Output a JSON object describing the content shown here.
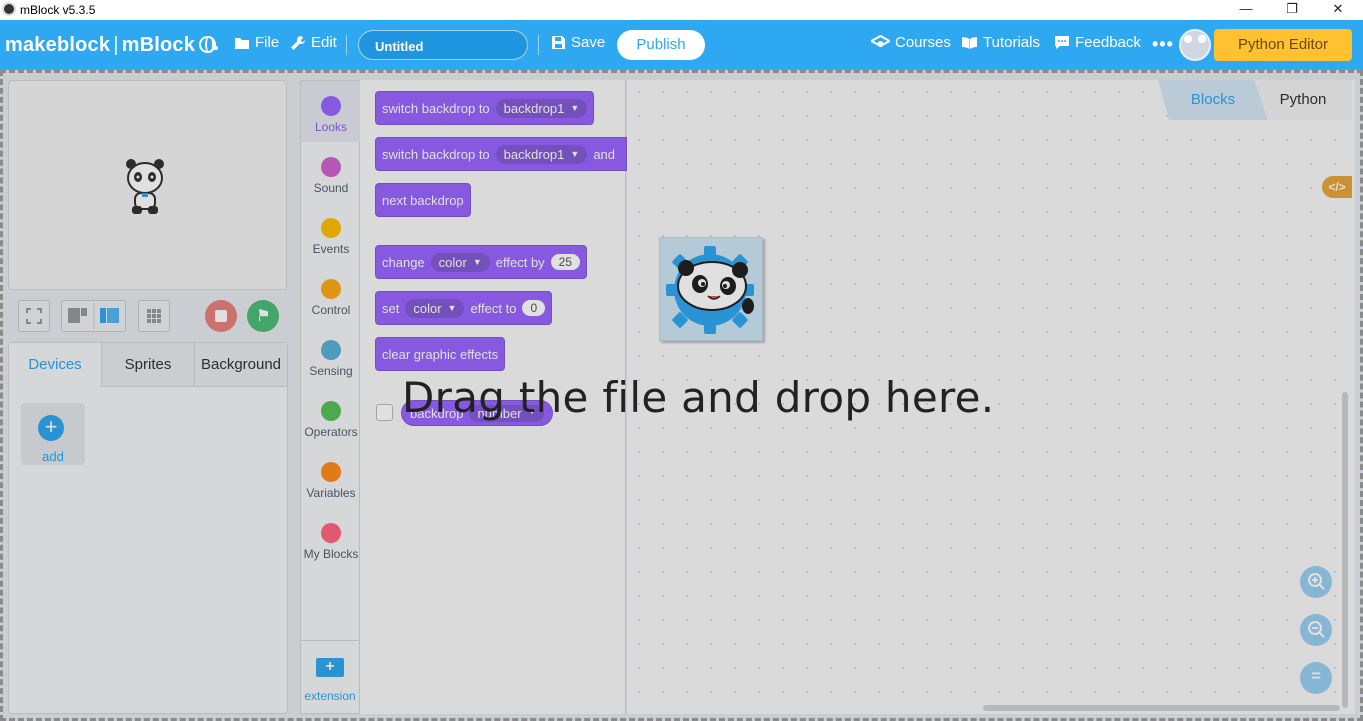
{
  "window": {
    "title": "mBlock v5.3.5",
    "minimize": "—",
    "maximize": "❐",
    "close": "✕"
  },
  "menubar": {
    "brand_left": "makeblock",
    "brand_sep": "|",
    "brand_right": "mBlock",
    "file": "File",
    "edit": "Edit",
    "project_title": "Untitled",
    "save": "Save",
    "publish": "Publish",
    "courses": "Courses",
    "tutorials": "Tutorials",
    "feedback": "Feedback",
    "more": "•••",
    "python_editor": "Python Editor",
    "accent_color": "#2fa8f2"
  },
  "left_tabs": {
    "devices": "Devices",
    "sprites": "Sprites",
    "background": "Background",
    "add_label": "add",
    "add_symbol": "+"
  },
  "categories": [
    {
      "label": "Looks",
      "color": "#9966ff"
    },
    {
      "label": "Sound",
      "color": "#cf63cf"
    },
    {
      "label": "Events",
      "color": "#ffbf00"
    },
    {
      "label": "Control",
      "color": "#ffab19"
    },
    {
      "label": "Sensing",
      "color": "#5cb1d6"
    },
    {
      "label": "Operators",
      "color": "#59c059"
    },
    {
      "label": "Variables",
      "color": "#ff8c1a"
    },
    {
      "label": "My Blocks",
      "color": "#ff6680"
    }
  ],
  "extension": {
    "label": "extension",
    "symbol": "+"
  },
  "blocks": {
    "b1": {
      "text": "switch backdrop to",
      "menu": "backdrop1"
    },
    "b2": {
      "text": "switch backdrop to",
      "menu": "backdrop1",
      "tail": "and"
    },
    "b3": {
      "text": "next backdrop"
    },
    "b4": {
      "text": "change",
      "menu": "color",
      "mid": "effect by",
      "value": "25"
    },
    "b5": {
      "text": "set",
      "menu": "color",
      "mid": "effect to",
      "value": "0"
    },
    "b6": {
      "text": "clear graphic effects"
    },
    "b7": {
      "text": "backdrop",
      "menu": "number"
    }
  },
  "code_tabs": {
    "blocks": "Blocks",
    "python": "Python"
  },
  "code_badge": "</>",
  "zoom": {
    "in": "+",
    "out": "−",
    "reset": "="
  },
  "drop_message": "Drag the file and drop here."
}
